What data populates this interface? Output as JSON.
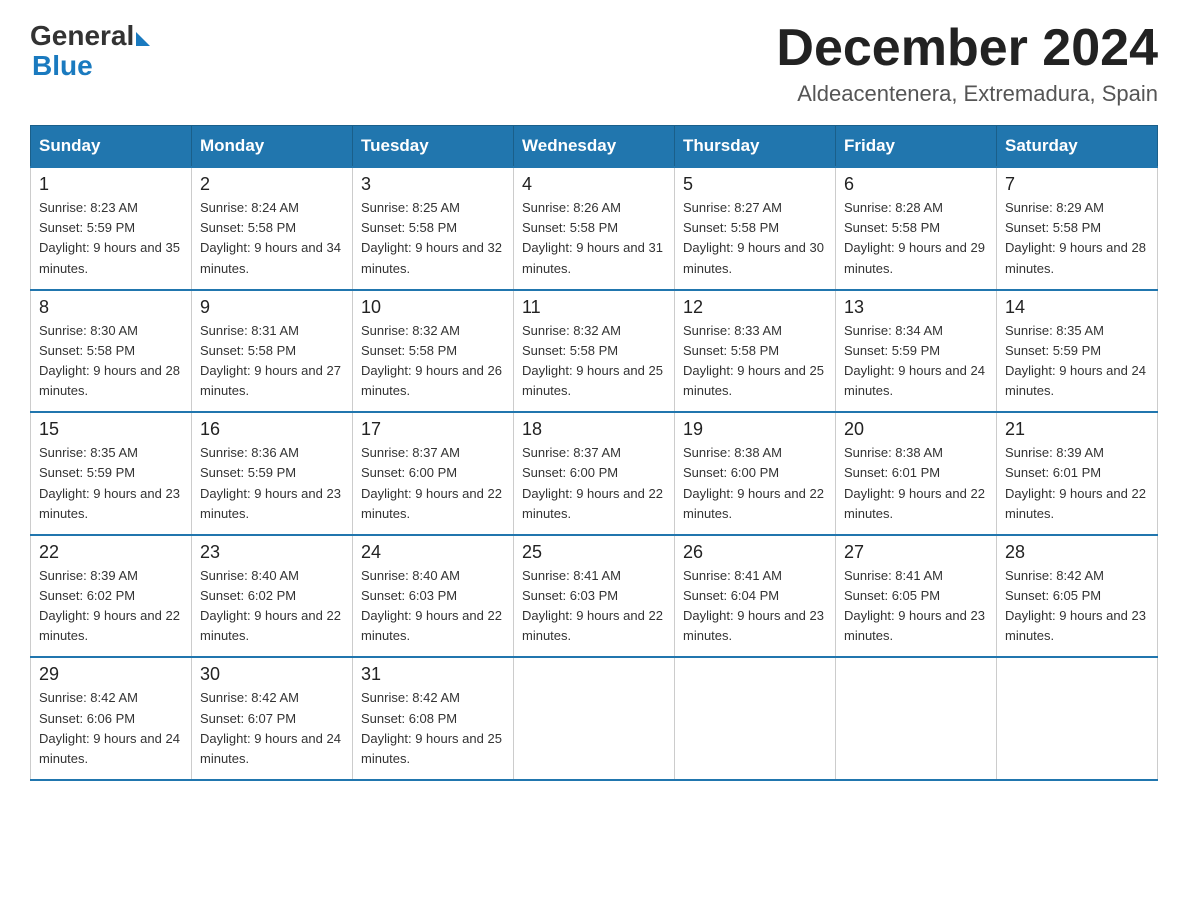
{
  "logo": {
    "general": "General",
    "blue": "Blue",
    "triangle_color": "#1a7abf"
  },
  "header": {
    "month": "December 2024",
    "location": "Aldeacentenera, Extremadura, Spain"
  },
  "days_of_week": [
    "Sunday",
    "Monday",
    "Tuesday",
    "Wednesday",
    "Thursday",
    "Friday",
    "Saturday"
  ],
  "weeks": [
    [
      {
        "day": 1,
        "sunrise": "8:23 AM",
        "sunset": "5:59 PM",
        "daylight": "9 hours and 35 minutes."
      },
      {
        "day": 2,
        "sunrise": "8:24 AM",
        "sunset": "5:58 PM",
        "daylight": "9 hours and 34 minutes."
      },
      {
        "day": 3,
        "sunrise": "8:25 AM",
        "sunset": "5:58 PM",
        "daylight": "9 hours and 32 minutes."
      },
      {
        "day": 4,
        "sunrise": "8:26 AM",
        "sunset": "5:58 PM",
        "daylight": "9 hours and 31 minutes."
      },
      {
        "day": 5,
        "sunrise": "8:27 AM",
        "sunset": "5:58 PM",
        "daylight": "9 hours and 30 minutes."
      },
      {
        "day": 6,
        "sunrise": "8:28 AM",
        "sunset": "5:58 PM",
        "daylight": "9 hours and 29 minutes."
      },
      {
        "day": 7,
        "sunrise": "8:29 AM",
        "sunset": "5:58 PM",
        "daylight": "9 hours and 28 minutes."
      }
    ],
    [
      {
        "day": 8,
        "sunrise": "8:30 AM",
        "sunset": "5:58 PM",
        "daylight": "9 hours and 28 minutes."
      },
      {
        "day": 9,
        "sunrise": "8:31 AM",
        "sunset": "5:58 PM",
        "daylight": "9 hours and 27 minutes."
      },
      {
        "day": 10,
        "sunrise": "8:32 AM",
        "sunset": "5:58 PM",
        "daylight": "9 hours and 26 minutes."
      },
      {
        "day": 11,
        "sunrise": "8:32 AM",
        "sunset": "5:58 PM",
        "daylight": "9 hours and 25 minutes."
      },
      {
        "day": 12,
        "sunrise": "8:33 AM",
        "sunset": "5:58 PM",
        "daylight": "9 hours and 25 minutes."
      },
      {
        "day": 13,
        "sunrise": "8:34 AM",
        "sunset": "5:59 PM",
        "daylight": "9 hours and 24 minutes."
      },
      {
        "day": 14,
        "sunrise": "8:35 AM",
        "sunset": "5:59 PM",
        "daylight": "9 hours and 24 minutes."
      }
    ],
    [
      {
        "day": 15,
        "sunrise": "8:35 AM",
        "sunset": "5:59 PM",
        "daylight": "9 hours and 23 minutes."
      },
      {
        "day": 16,
        "sunrise": "8:36 AM",
        "sunset": "5:59 PM",
        "daylight": "9 hours and 23 minutes."
      },
      {
        "day": 17,
        "sunrise": "8:37 AM",
        "sunset": "6:00 PM",
        "daylight": "9 hours and 22 minutes."
      },
      {
        "day": 18,
        "sunrise": "8:37 AM",
        "sunset": "6:00 PM",
        "daylight": "9 hours and 22 minutes."
      },
      {
        "day": 19,
        "sunrise": "8:38 AM",
        "sunset": "6:00 PM",
        "daylight": "9 hours and 22 minutes."
      },
      {
        "day": 20,
        "sunrise": "8:38 AM",
        "sunset": "6:01 PM",
        "daylight": "9 hours and 22 minutes."
      },
      {
        "day": 21,
        "sunrise": "8:39 AM",
        "sunset": "6:01 PM",
        "daylight": "9 hours and 22 minutes."
      }
    ],
    [
      {
        "day": 22,
        "sunrise": "8:39 AM",
        "sunset": "6:02 PM",
        "daylight": "9 hours and 22 minutes."
      },
      {
        "day": 23,
        "sunrise": "8:40 AM",
        "sunset": "6:02 PM",
        "daylight": "9 hours and 22 minutes."
      },
      {
        "day": 24,
        "sunrise": "8:40 AM",
        "sunset": "6:03 PM",
        "daylight": "9 hours and 22 minutes."
      },
      {
        "day": 25,
        "sunrise": "8:41 AM",
        "sunset": "6:03 PM",
        "daylight": "9 hours and 22 minutes."
      },
      {
        "day": 26,
        "sunrise": "8:41 AM",
        "sunset": "6:04 PM",
        "daylight": "9 hours and 23 minutes."
      },
      {
        "day": 27,
        "sunrise": "8:41 AM",
        "sunset": "6:05 PM",
        "daylight": "9 hours and 23 minutes."
      },
      {
        "day": 28,
        "sunrise": "8:42 AM",
        "sunset": "6:05 PM",
        "daylight": "9 hours and 23 minutes."
      }
    ],
    [
      {
        "day": 29,
        "sunrise": "8:42 AM",
        "sunset": "6:06 PM",
        "daylight": "9 hours and 24 minutes."
      },
      {
        "day": 30,
        "sunrise": "8:42 AM",
        "sunset": "6:07 PM",
        "daylight": "9 hours and 24 minutes."
      },
      {
        "day": 31,
        "sunrise": "8:42 AM",
        "sunset": "6:08 PM",
        "daylight": "9 hours and 25 minutes."
      },
      null,
      null,
      null,
      null
    ]
  ]
}
